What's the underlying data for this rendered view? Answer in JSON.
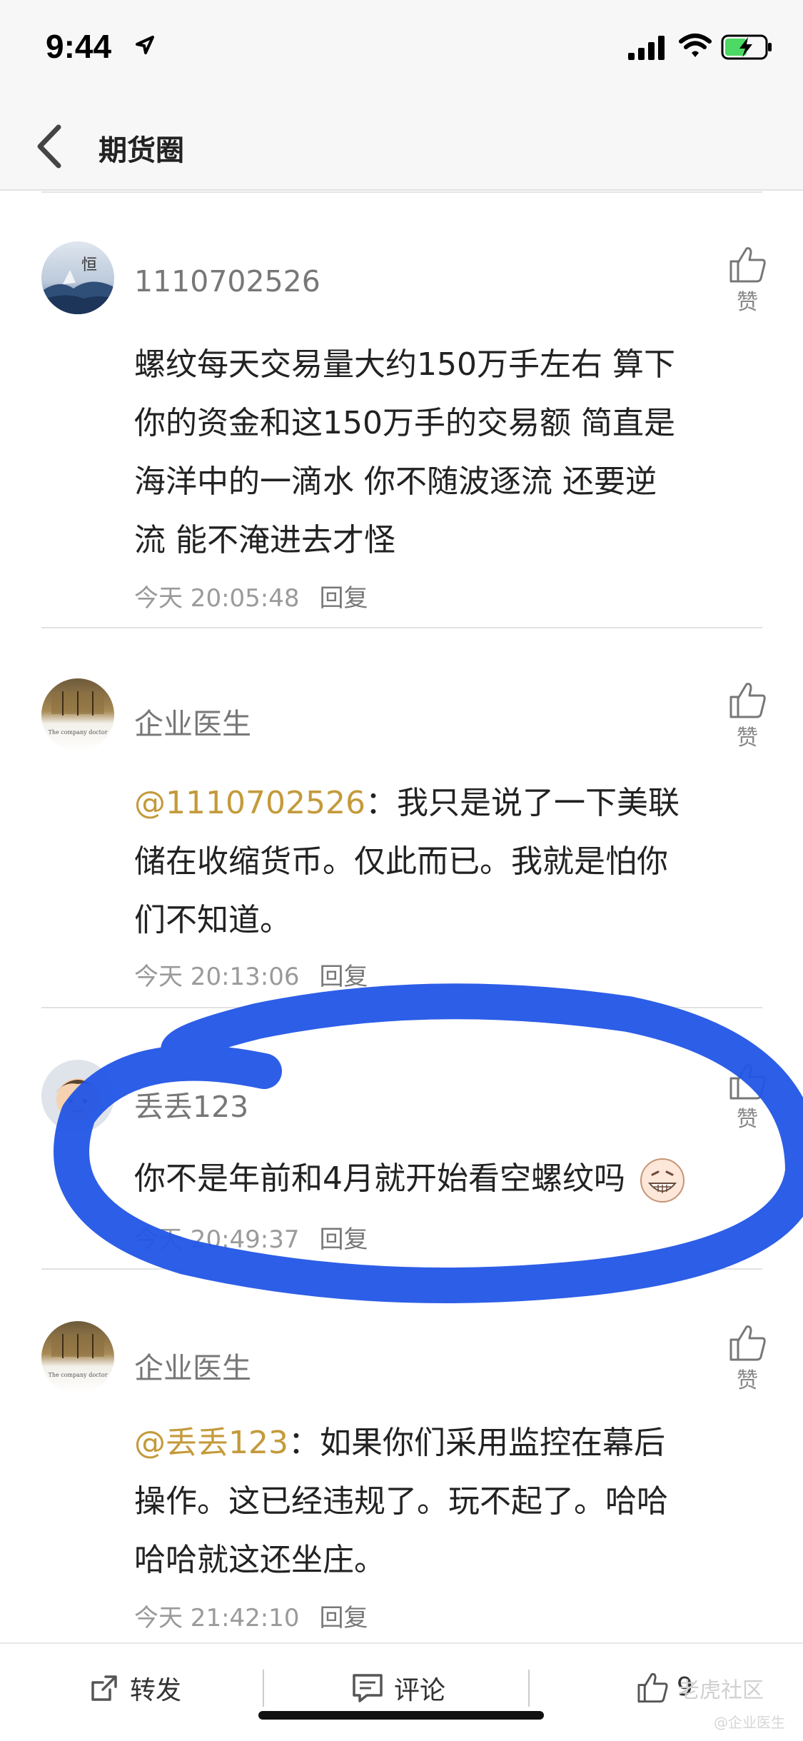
{
  "status_bar": {
    "time": "9:44"
  },
  "nav": {
    "title": "期货圈"
  },
  "comments": [
    {
      "username": "1110702526",
      "avatar_text": "恒",
      "body_lines": [
        "螺纹每天交易量大约150万手左右 算下",
        "你的资金和这150万手的交易额 简直是",
        "海洋中的一滴水 你不随波逐流 还要逆",
        "流 能不淹进去才怪"
      ],
      "time": "今天 20:05:48",
      "reply_label": "回复",
      "like_label": "赞"
    },
    {
      "username": "企业医生",
      "avatar_text": "The company doctor",
      "mention": "@1110702526",
      "body_first": "：我只是说了一下美联",
      "body_lines": [
        "储在收缩货币。仅此而已。我就是怕你",
        "们不知道。"
      ],
      "time": "今天 20:13:06",
      "reply_label": "回复",
      "like_label": "赞"
    },
    {
      "username": "丢丢123",
      "body_lines": [
        "你不是年前和4月就开始看空螺纹吗"
      ],
      "time": "今天 20:49:37",
      "reply_label": "回复",
      "like_label": "赞"
    },
    {
      "username": "企业医生",
      "avatar_text": "The company doctor",
      "mention": "@丢丢123",
      "body_first": "：如果你们采用监控在幕后",
      "body_lines": [
        "操作。这已经违规了。玩不起了。哈哈",
        "哈哈就这还坐庄。"
      ],
      "time": "今天 21:42:10",
      "reply_label": "回复",
      "like_label": "赞"
    }
  ],
  "bottom_bar": {
    "share_label": "转发",
    "comment_label": "评论",
    "like_count": "9"
  },
  "watermark": {
    "main": "老虎社区",
    "sub": "@企业医生"
  },
  "colors": {
    "mention": "#c49a3b",
    "highlight": "#2255e6"
  }
}
